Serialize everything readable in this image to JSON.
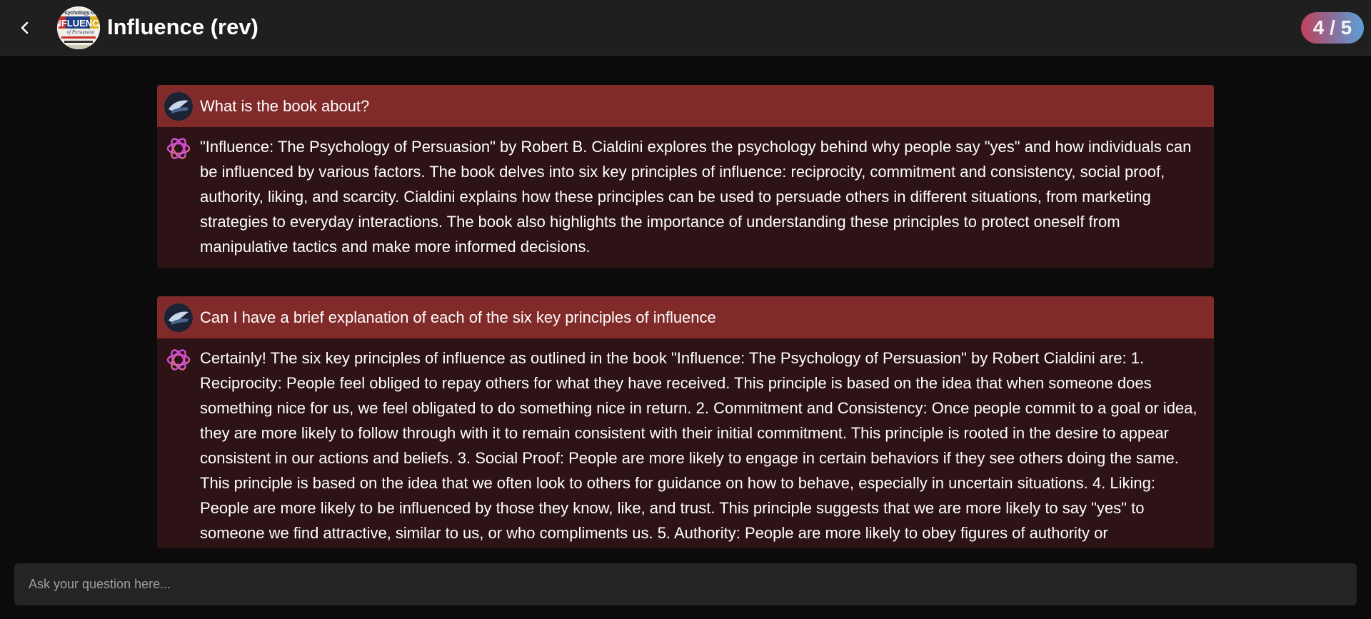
{
  "header": {
    "title": "Influence (rev)",
    "counter": "4 / 5",
    "cover_lines": [
      "Psychology of",
      "INFLUENCE",
      "of Persuasion"
    ]
  },
  "messages": [
    {
      "question": "What is the book about?",
      "answer": "\"Influence: The Psychology of Persuasion\" by Robert B. Cialdini explores the psychology behind why people say \"yes\" and how individuals can be influenced by various factors. The book delves into six key principles of influence: reciprocity, commitment and consistency, social proof, authority, liking, and scarcity. Cialdini explains how these principles can be used to persuade others in different situations, from marketing strategies to everyday interactions. The book also highlights the importance of understanding these principles to protect oneself from manipulative tactics and make more informed decisions."
    },
    {
      "question": "Can I have a brief explanation of each of the six key principles of influence",
      "answer": "Certainly! The six key principles of influence as outlined in the book \"Influence: The Psychology of Persuasion\" by Robert Cialdini are: 1. Reciprocity: People feel obliged to repay others for what they have received. This principle is based on the idea that when someone does something nice for us, we feel obligated to do something nice in return. 2. Commitment and Consistency: Once people commit to a goal or idea, they are more likely to follow through with it to remain consistent with their initial commitment. This principle is rooted in the desire to appear consistent in our actions and beliefs. 3. Social Proof: People are more likely to engage in certain behaviors if they see others doing the same. This principle is based on the idea that we often look to others for guidance on how to behave, especially in uncertain situations. 4. Liking: People are more likely to be influenced by those they know, like, and trust. This principle suggests that we are more likely to say \"yes\" to someone we find attractive, similar to us, or who compliments us. 5. Authority: People are more likely to obey figures of authority or"
    }
  ],
  "input": {
    "placeholder": "Ask your question here...",
    "value": ""
  },
  "colors": {
    "question_bg": "#802a2a",
    "answer_bg": "#2d1315",
    "header_bg": "#1f1f1f",
    "page_bg": "#0b0b0b"
  },
  "icons": {
    "back": "chevron-left-icon",
    "user": "user-avatar-icon",
    "assistant": "openai-logo-icon"
  }
}
